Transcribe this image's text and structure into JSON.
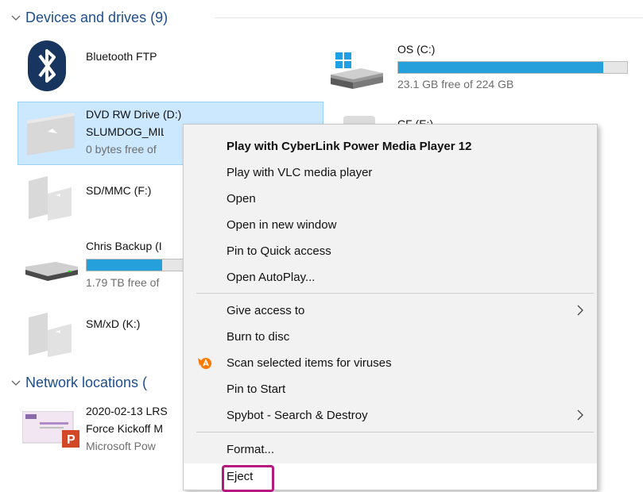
{
  "groups": {
    "devices": {
      "title": "Devices and drives (9)"
    },
    "network": {
      "title": "Network locations ("
    }
  },
  "drives": {
    "bluetooth": {
      "name": "Bluetooth FTP"
    },
    "os": {
      "name": "OS (C:)",
      "free": "23.1 GB free of 224 GB",
      "usage": 0.897
    },
    "dvd": {
      "name": "DVD RW Drive (D:)",
      "label": "SLUMDOG_MIL",
      "free": "0 bytes free of"
    },
    "cf": {
      "name": "CF (E:)"
    },
    "sdmmc": {
      "name": "SD/MMC (F:)"
    },
    "backup": {
      "name": "Chris Backup (I",
      "free": "1.79 TB free of",
      "usage": 0.78
    },
    "smxd": {
      "name": "SM/xD (K:)"
    }
  },
  "network_items": [
    {
      "line1": "2020-02-13 LRS",
      "line2": "Force Kickoff M",
      "line3": "Microsoft Pow",
      "thumb_text": "P"
    }
  ],
  "context_menu": {
    "items": [
      {
        "label": "Play with CyberLink Power Media Player 12",
        "bold": true
      },
      {
        "label": "Play with VLC media player"
      },
      {
        "label": "Open"
      },
      {
        "label": "Open in new window"
      },
      {
        "label": "Pin to Quick access"
      },
      {
        "label": "Open AutoPlay..."
      },
      {
        "label": "Give access to",
        "submenu": true
      },
      {
        "label": "Burn to disc"
      },
      {
        "label": "Scan selected items for viruses",
        "icon": "avast-icon"
      },
      {
        "label": "Pin to Start"
      },
      {
        "label": "Spybot - Search & Destroy",
        "submenu": true
      },
      {
        "label": "Format..."
      },
      {
        "label": "Eject"
      }
    ]
  },
  "colors": {
    "accent": "#26a0da",
    "selection": "#cce8ff",
    "highlight_box": "#b5197f",
    "group_title": "#1e4e8c",
    "avast": "#ff7800"
  }
}
